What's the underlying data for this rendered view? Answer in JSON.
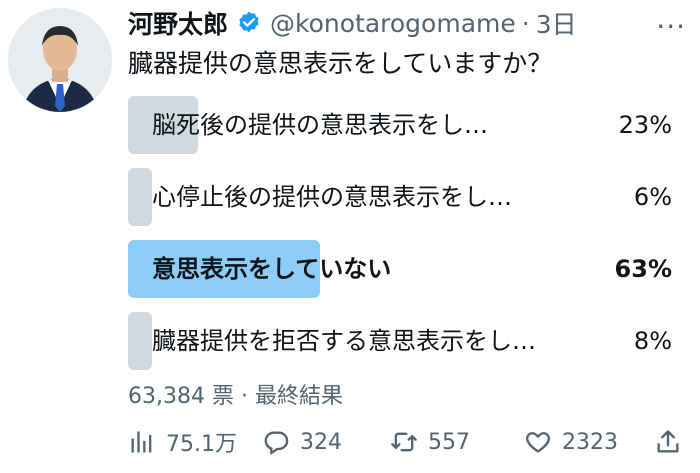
{
  "tweet": {
    "author_name": "河野太郎",
    "handle": "@konotarogomame",
    "time_sep": "·",
    "time": "3日",
    "more_label": "···",
    "question": "臓器提供の意思表示をしていますか？"
  },
  "poll": {
    "options": [
      {
        "label": "脳死後の提供の意思表示をし…",
        "percent_label": "23%",
        "percent": 23,
        "winner": false
      },
      {
        "label": "心停止後の提供の意思表示をし…",
        "percent_label": "6%",
        "percent": 6,
        "winner": false
      },
      {
        "label": "意思表示をしていない",
        "percent_label": "63%",
        "percent": 63,
        "winner": true
      },
      {
        "label": "臓器提供を拒否する意思表示をし…",
        "percent_label": "8%",
        "percent": 8,
        "winner": false
      }
    ],
    "meta": "63,384 票 · 最終結果"
  },
  "actions": {
    "views": "75.1万",
    "replies": "324",
    "retweets": "557",
    "likes": "2323"
  },
  "colors": {
    "accent": "#1d9bf0",
    "bar": "#cfd9de",
    "bar_winner": "#8ecdf8",
    "muted": "#536471"
  },
  "icons": [
    "verified-badge-icon",
    "more-icon",
    "views-icon",
    "reply-icon",
    "retweet-icon",
    "like-icon",
    "share-icon"
  ]
}
